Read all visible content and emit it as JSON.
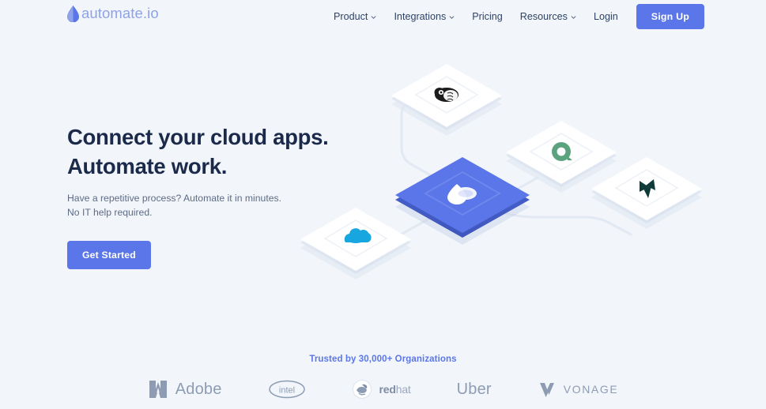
{
  "brand": {
    "name": "automate.io",
    "icon": "water-drop-icon",
    "color": "#8ea2e8"
  },
  "nav": {
    "items": [
      {
        "label": "Product",
        "has_chevron": true
      },
      {
        "label": "Integrations",
        "has_chevron": true
      },
      {
        "label": "Pricing",
        "has_chevron": false
      },
      {
        "label": "Resources",
        "has_chevron": true
      },
      {
        "label": "Login",
        "has_chevron": false
      }
    ],
    "signup_label": "Sign Up"
  },
  "hero": {
    "headline_line1": "Connect your cloud apps.",
    "headline_line2": "Automate work.",
    "sub_line1": "Have a repetitive process? Automate it in minutes.",
    "sub_line2": "No IT help required.",
    "cta_label": "Get Started"
  },
  "illustration": {
    "nodes": [
      {
        "id": "mailchimp",
        "icon": "mailchimp-monkey-icon",
        "color": "#1a1a1a",
        "active": false
      },
      {
        "id": "evernote",
        "icon": "green-circle-icon",
        "color": "#5ba37f",
        "active": false
      },
      {
        "id": "jira",
        "icon": "dark-butterfly-icon",
        "color": "#0d3b3b",
        "active": false
      },
      {
        "id": "automate",
        "icon": "water-drop-icon",
        "color": "#ffffff",
        "active": true
      },
      {
        "id": "salesforce",
        "icon": "salesforce-cloud-icon",
        "color": "#17a6e0",
        "active": false
      }
    ],
    "card_face": "#ffffff",
    "active_face": "#5b76e8",
    "connector_color": "#e2e8f2"
  },
  "trust": {
    "title": "Trusted by 30,000+ Organizations",
    "title_color": "#5b76e8",
    "logos": [
      {
        "name": "Adobe",
        "icon": "adobe-a-icon"
      },
      {
        "name": "intel",
        "icon": "intel-oval-icon"
      },
      {
        "name": "redhat",
        "icon": "redhat-shadowman-icon",
        "bold_part": "red",
        "light_part": "hat"
      },
      {
        "name": "Uber",
        "icon": "uber-wordmark"
      },
      {
        "name": "VONAGE",
        "icon": "vonage-v-icon"
      }
    ]
  },
  "colors": {
    "background": "#f2f6fb",
    "accent": "#5b76e8",
    "heading": "#1b2a4a",
    "body": "#5d6b85"
  }
}
